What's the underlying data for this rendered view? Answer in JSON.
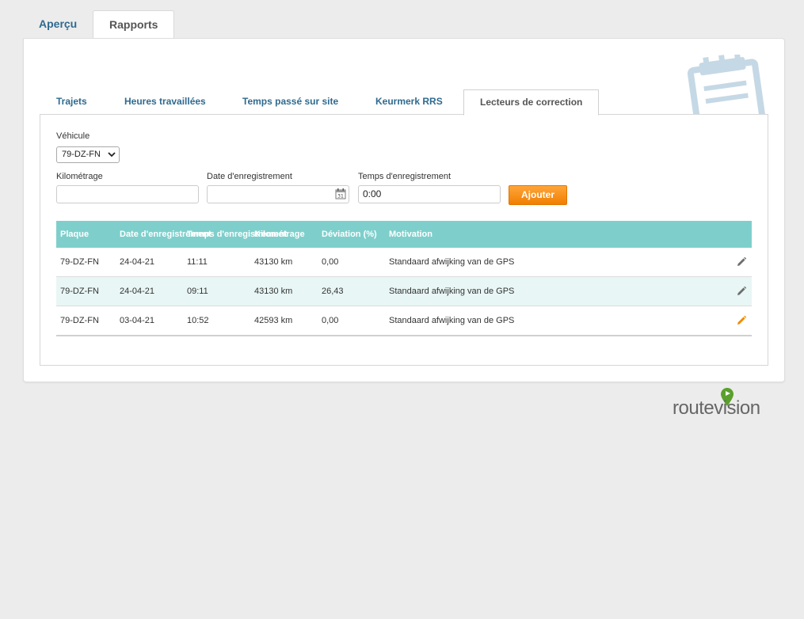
{
  "top_tabs": [
    {
      "label": "Aperçu"
    },
    {
      "label": "Rapports"
    }
  ],
  "sub_tabs": [
    {
      "label": "Trajets"
    },
    {
      "label": "Heures travaillées"
    },
    {
      "label": "Temps passé sur site"
    },
    {
      "label": "Keurmerk RRS"
    },
    {
      "label": "Lecteurs de correction"
    }
  ],
  "form": {
    "vehicle_label": "Véhicule",
    "vehicle_value": "79-DZ-FN",
    "km_label": "Kilométrage",
    "km_value": "",
    "date_label": "Date d'enregistrement",
    "date_value": "",
    "time_label": "Temps d'enregistrement",
    "time_value": "0:00",
    "add_label": "Ajouter"
  },
  "table": {
    "headers": [
      "Plaque",
      "Date d'enregistrement",
      "Temps d'enregistrement",
      "Kilométrage",
      "Déviation (%)",
      "Motivation"
    ],
    "rows": [
      {
        "plate": "79-DZ-FN",
        "date": "24-04-21",
        "time": "11:11",
        "km": "43130 km",
        "dev": "0,00",
        "motivation": "Standaard afwijking van de GPS"
      },
      {
        "plate": "79-DZ-FN",
        "date": "24-04-21",
        "time": "09:11",
        "km": "43130 km",
        "dev": "26,43",
        "motivation": "Standaard afwijking van de GPS"
      },
      {
        "plate": "79-DZ-FN",
        "date": "03-04-21",
        "time": "10:52",
        "km": "42593 km",
        "dev": "0,00",
        "motivation": "Standaard afwijking van de GPS"
      }
    ]
  },
  "logo": {
    "text": "routevision",
    "accent": "#5aa02c"
  },
  "colors": {
    "header_teal": "#7ecfcc",
    "button_orange": "#f48a10",
    "link_blue": "#2f6a8f"
  }
}
